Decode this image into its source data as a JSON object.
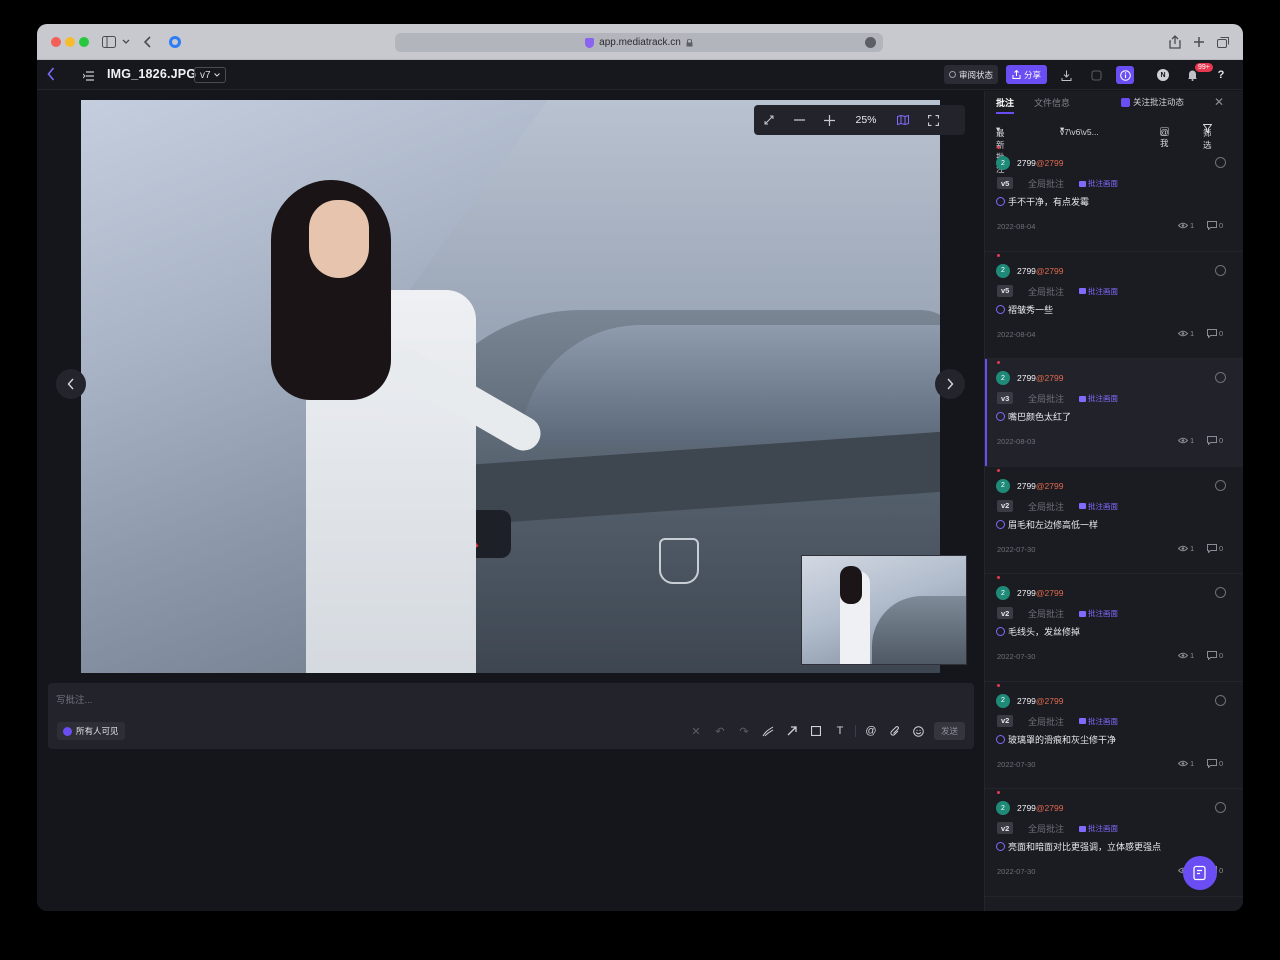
{
  "browser": {
    "url": "app.mediatrack.cn"
  },
  "header": {
    "filename": "IMG_1826.JPG",
    "version": "v7",
    "review_label": "审阅状态",
    "share_label": "分享",
    "notif_badge": "99+",
    "help": "?"
  },
  "viewer": {
    "zoom": "25%",
    "composer_placeholder": "写批注...",
    "visibility_label": "所有人可见",
    "send_label": "发送"
  },
  "panel": {
    "tabs": [
      {
        "label": "批注"
      },
      {
        "label": "文件信息"
      }
    ],
    "follow_label": "关注批注动态",
    "sort_label": "最新批注",
    "version_filter": "v7\\v6\\v5...",
    "mention_label": "@我",
    "filter_label": "筛选",
    "comments": [
      {
        "avatar": "2",
        "user": "2799",
        "at_user": "@2799",
        "version": "v5",
        "scope": "全局批注",
        "anno_label": "批注画面",
        "text": "手不干净，有点发霉",
        "date": "2022-08-04",
        "views": "1",
        "replies": "0"
      },
      {
        "avatar": "2",
        "user": "2799",
        "at_user": "@2799",
        "version": "v5",
        "scope": "全局批注",
        "anno_label": "批注画面",
        "text": "褶皱秀一些",
        "date": "2022-08-04",
        "views": "1",
        "replies": "0"
      },
      {
        "avatar": "2",
        "user": "2799",
        "at_user": "@2799",
        "version": "v3",
        "scope": "全局批注",
        "anno_label": "批注画面",
        "text": "嘴巴颜色太红了",
        "date": "2022-08-03",
        "views": "1",
        "replies": "0"
      },
      {
        "avatar": "2",
        "user": "2799",
        "at_user": "@2799",
        "version": "v2",
        "scope": "全局批注",
        "anno_label": "批注画面",
        "text": "眉毛和左边修高低一样",
        "date": "2022-07-30",
        "views": "1",
        "replies": "0"
      },
      {
        "avatar": "2",
        "user": "2799",
        "at_user": "@2799",
        "version": "v2",
        "scope": "全局批注",
        "anno_label": "批注画面",
        "text": "毛线头，发丝修掉",
        "date": "2022-07-30",
        "views": "1",
        "replies": "0"
      },
      {
        "avatar": "2",
        "user": "2799",
        "at_user": "@2799",
        "version": "v2",
        "scope": "全局批注",
        "anno_label": "批注画面",
        "text": "玻璃罩的滑痕和灰尘修干净",
        "date": "2022-07-30",
        "views": "1",
        "replies": "0"
      },
      {
        "avatar": "2",
        "user": "2799",
        "at_user": "@2799",
        "version": "v2",
        "scope": "全局批注",
        "anno_label": "批注画面",
        "text": "亮面和暗面对比更强调，立体感更强点",
        "date": "2022-07-30",
        "views": "1",
        "replies": "0"
      }
    ]
  },
  "colors": {
    "accent": "#6a4ef3",
    "background": "#15161c",
    "panel": "#1b1c22",
    "alert": "#e8384f"
  }
}
